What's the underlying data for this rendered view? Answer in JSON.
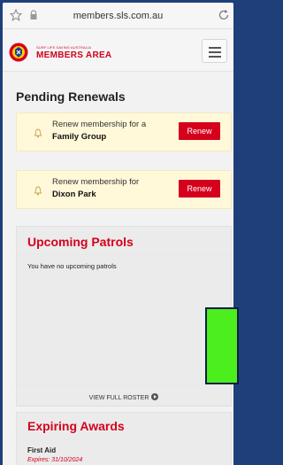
{
  "browser": {
    "url": "members.sls.com.au"
  },
  "header": {
    "logo_small": "SURF LIFE SAVING AUSTRALIA",
    "logo_big": "MEMBERS AREA"
  },
  "renewals": {
    "title": "Pending Renewals",
    "items": [
      {
        "message": "Renew membership for a ",
        "highlight": "Family Group",
        "button": "Renew"
      },
      {
        "message": "Renew membership for ",
        "highlight": "Dixon Park",
        "button": "Renew"
      }
    ]
  },
  "patrols": {
    "title": "Upcoming Patrols",
    "empty_text": "You have no upcoming patrols",
    "roster_link": "VIEW FULL ROSTER"
  },
  "awards": {
    "title": "Expiring Awards",
    "items": [
      {
        "name": "First Aid",
        "expires": "Expires: 31/10/2024"
      }
    ]
  },
  "colors": {
    "brand_red": "#d5001c",
    "alert_bg": "#fff8d9",
    "background": "#1e3f7a"
  }
}
